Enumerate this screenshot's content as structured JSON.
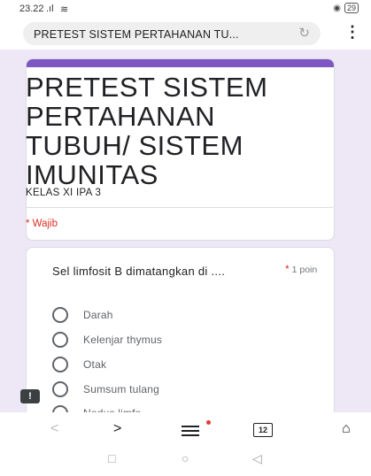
{
  "status_bar": {
    "time": "23.22",
    "signal": ".ıl",
    "wifi": "≋",
    "battery": "29"
  },
  "browser": {
    "url_text": "PRETEST SISTEM PERTAHANAN TU...",
    "reload_icon": "reload-icon",
    "menu_icon": "more-vert-icon"
  },
  "form": {
    "title": "PRETEST SISTEM PERTAHANAN TUBUH/ SISTEM IMUNITAS",
    "description": "KELAS XI IPA 3",
    "required_note": "* Wajib",
    "accent_color": "#7e57c2"
  },
  "question": {
    "text": "Sel limfosit B dimatangkan di ....",
    "required_star": "*",
    "points": "1 poin",
    "options": [
      "Darah",
      "Kelenjar thymus",
      "Otak",
      "Sumsum tulang",
      "Nodus limfe"
    ]
  },
  "navbar": {
    "tabs_count": "12",
    "back": "<",
    "forward": ">"
  }
}
